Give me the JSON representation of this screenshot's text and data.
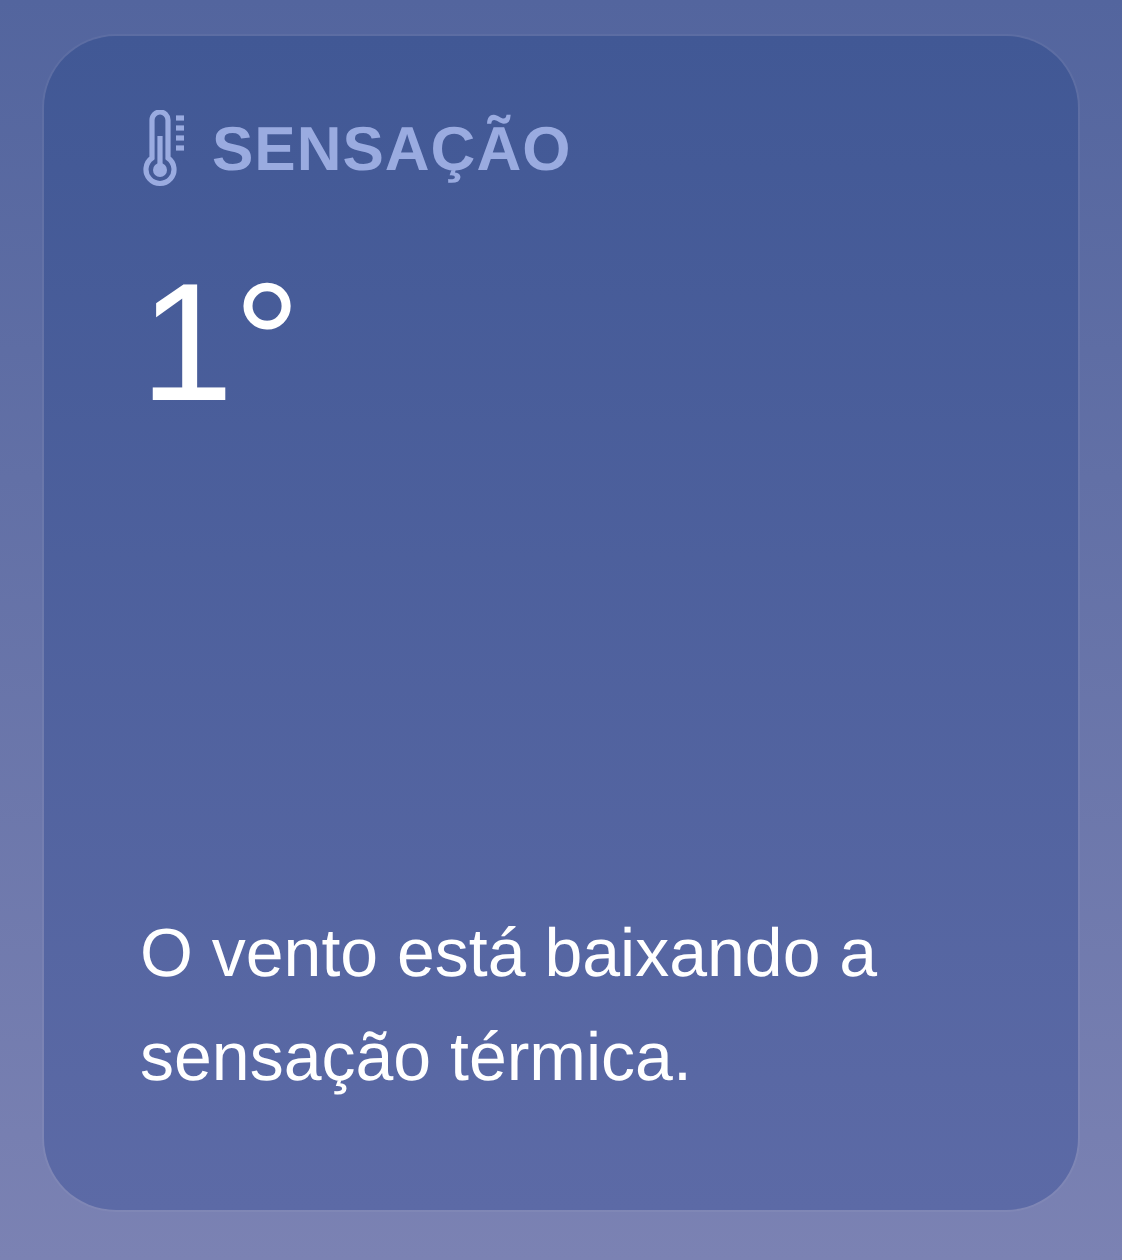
{
  "widget": {
    "title": "SENSAÇÃO",
    "value": "1°",
    "description": "O vento está baixando a sensação térmica."
  }
}
